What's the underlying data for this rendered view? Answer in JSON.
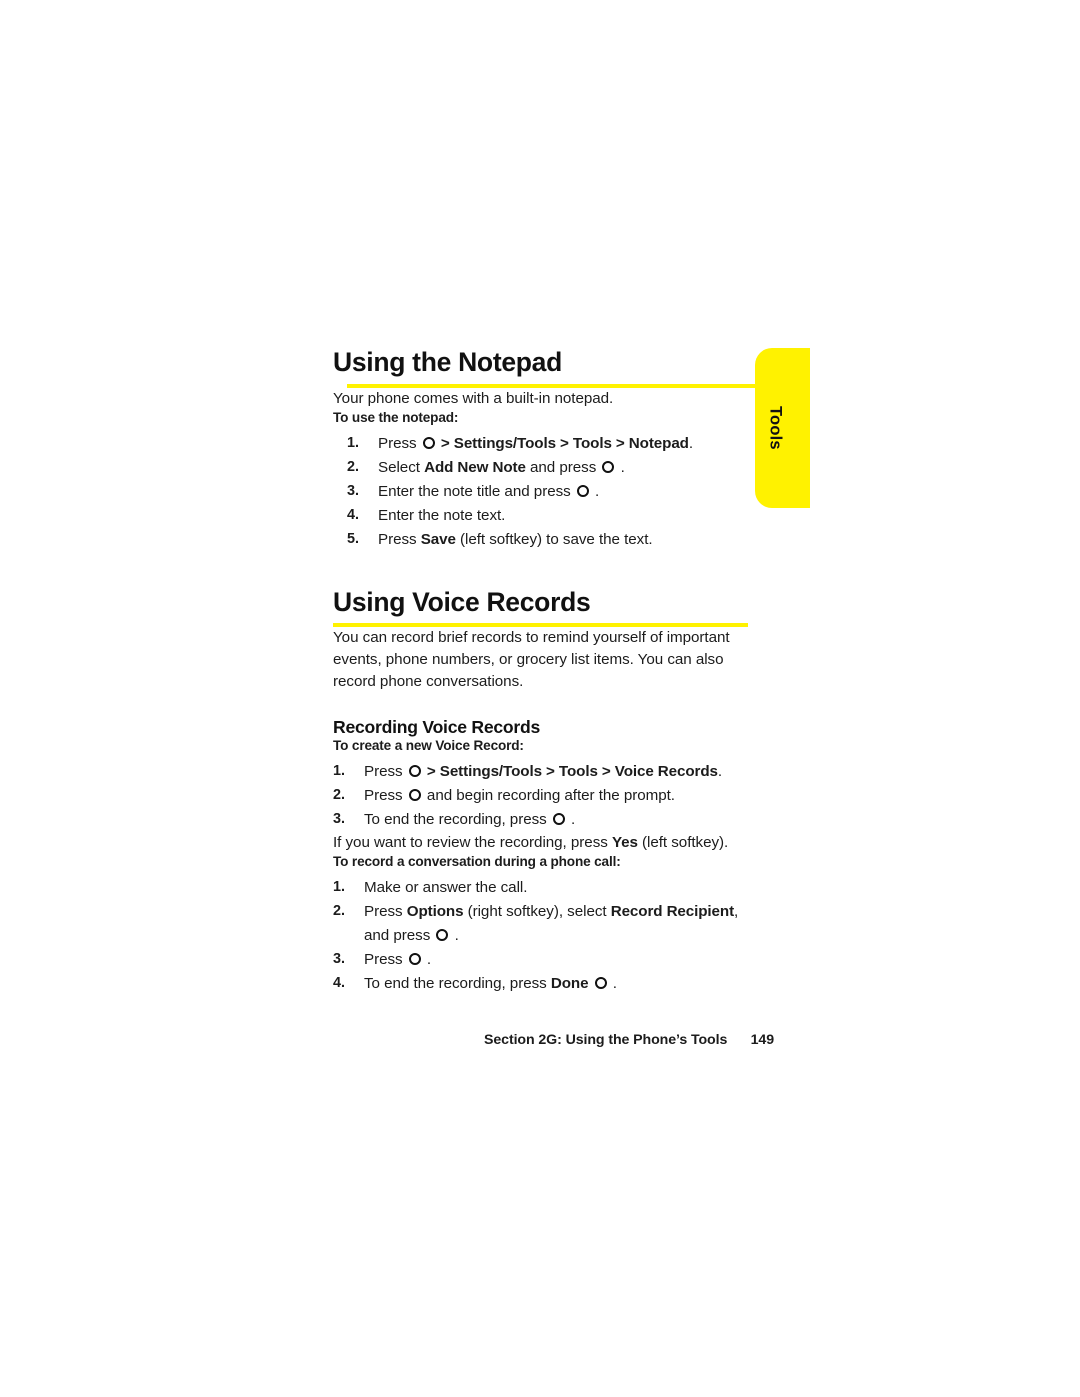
{
  "thumb_tab": {
    "label": "Tools",
    "color": "#fff200"
  },
  "sections": [
    {
      "heading": "Using the Notepad",
      "lead": "Your phone comes with a built-in notepad.",
      "procedure_label": "To use the notepad:",
      "steps": [
        {
          "num": "1.",
          "html": "Press <span class=\"keyo\" data-name=\"center-key-icon\" data-interactable=\"false\"></span> <b>&gt; Settings/Tools &gt; Tools &gt; Notepad</b>."
        },
        {
          "num": "2.",
          "html": "Select <b>Add New Note</b> and press <span class=\"keyo\" data-name=\"center-key-icon\" data-interactable=\"false\"></span> ."
        },
        {
          "num": "3.",
          "html": "Enter the note title and press <span class=\"keyo\" data-name=\"center-key-icon\" data-interactable=\"false\"></span> ."
        },
        {
          "num": "4.",
          "html": "Enter the note text."
        },
        {
          "num": "5.",
          "html": "Press <b>Save</b> (left softkey) to save the text."
        }
      ]
    },
    {
      "heading": "Using Voice Records",
      "lead": "You can record brief records to remind yourself of important events, phone numbers, or grocery list items. You can also record phone conversations.",
      "sub_heading": "Recording Voice Records",
      "procedure_label_1": "To create a new Voice Record:",
      "steps_1": [
        {
          "num": "1.",
          "html": "Press <span class=\"keyo\" data-name=\"center-key-icon\" data-interactable=\"false\"></span> <b>&gt; Settings/Tools &gt; Tools &gt; Voice Records</b>."
        },
        {
          "num": "2.",
          "html": "Press <span class=\"keyo\" data-name=\"center-key-icon\" data-interactable=\"false\"></span> and begin recording after the prompt."
        },
        {
          "num": "3.",
          "html": "To end the recording, press <span class=\"keyo\" data-name=\"center-key-icon\" data-interactable=\"false\"></span> ."
        }
      ],
      "review_note": "If you want to review the recording, press <b>Yes</b> (left softkey).",
      "procedure_label_2": "To record a conversation during a phone call:",
      "steps_2": [
        {
          "num": "1.",
          "html": "Make or answer the call."
        },
        {
          "num": "2.",
          "html": "Press <b>Options</b> (right softkey), select <b>Record Recipient</b>, and press <span class=\"keyo\" data-name=\"center-key-icon\" data-interactable=\"false\"></span> ."
        },
        {
          "num": "3.",
          "html": "Press <span class=\"keyo\" data-name=\"center-key-icon\" data-interactable=\"false\"></span> ."
        },
        {
          "num": "4.",
          "html": "To end the recording, press <b>Done</b> <span class=\"keyo\" data-name=\"center-key-icon\" data-interactable=\"false\"></span> ."
        }
      ]
    }
  ],
  "footer": {
    "section_text": "Section 2G: Using the Phone’s Tools",
    "page_number": "149"
  }
}
